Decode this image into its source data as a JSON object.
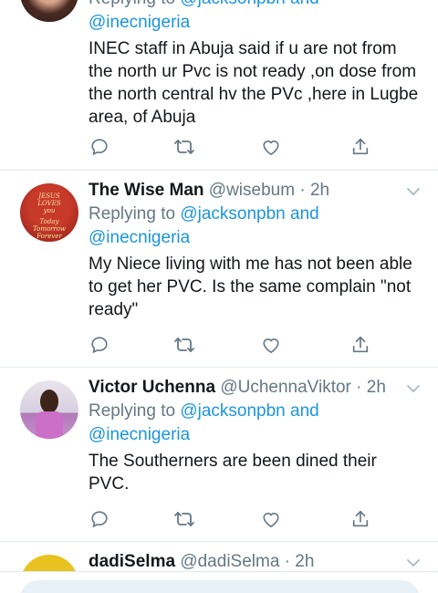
{
  "tweets": [
    {
      "reply_prefix": "Replying to ",
      "reply_user_1": "@jacksonpbn",
      "reply_and": " and",
      "reply_user_2": "@inecnigeria",
      "text": "INEC staff in Abuja said if u are not from the north ur Pvc  is not ready  ,on dose from the north central hv the PVc  ,here in Lugbe area, of Abuja"
    },
    {
      "name": "The Wise Man",
      "handle": "@wisebum",
      "dot": " · ",
      "time": "2h",
      "reply_prefix": "Replying to ",
      "reply_user_1": "@jacksonpbn",
      "reply_and": " and",
      "reply_user_2": "@inecnigeria",
      "text": "My Niece living with me has not been able to get her PVC. Is the same complain \"not ready\"",
      "avatar_text": [
        "JESUS",
        "LOVES",
        "you",
        "Today",
        "Tomorrow",
        "Forever"
      ]
    },
    {
      "name": "Victor Uchenna",
      "handle": "@UchennaViktor",
      "dot": " · ",
      "time": "2h",
      "reply_prefix": "Replying to ",
      "reply_user_1": "@jacksonpbn",
      "reply_and": " and",
      "reply_user_2": "@inecnigeria",
      "text": "The Southerners are been dined their PVC."
    },
    {
      "name": "dadiSelma",
      "handle": "@dadiSelma",
      "dot": " · ",
      "time": "2h"
    }
  ],
  "icons": [
    "reply-icon",
    "retweet-icon",
    "like-icon",
    "share-icon",
    "chevron-down-icon"
  ],
  "colors": {
    "link": "#1b95e0",
    "muted": "#657786",
    "divider": "#e1e8ed"
  }
}
